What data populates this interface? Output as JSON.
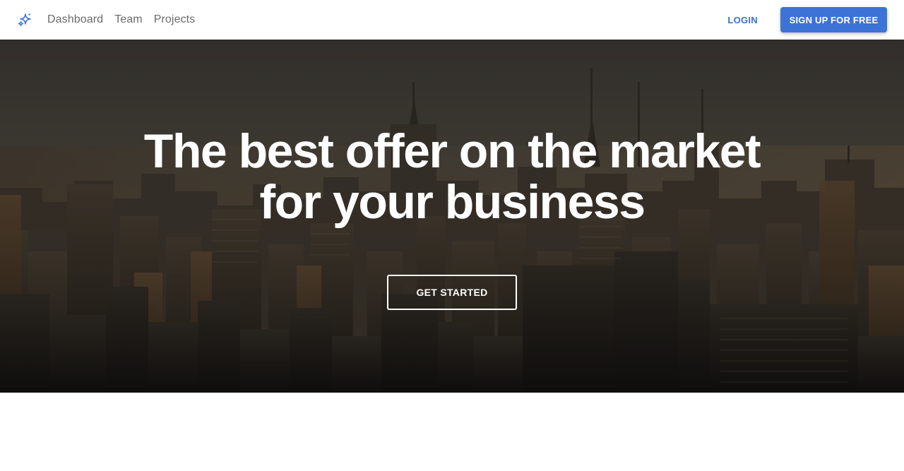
{
  "brand": {
    "icon": "sparkles-icon",
    "color": "#3d72d6"
  },
  "nav": {
    "links": [
      {
        "label": "Dashboard"
      },
      {
        "label": "Team"
      },
      {
        "label": "Projects"
      }
    ],
    "login_label": "LOGIN",
    "signup_label": "SIGN UP FOR FREE"
  },
  "hero": {
    "title_line1": "The best offer on the market",
    "title_line2": "for your business",
    "cta_label": "GET STARTED",
    "background": "city-skyline-photo"
  },
  "colors": {
    "accent": "#3d72d6",
    "nav_text": "#6b6b6b",
    "hero_text": "#ffffff"
  }
}
